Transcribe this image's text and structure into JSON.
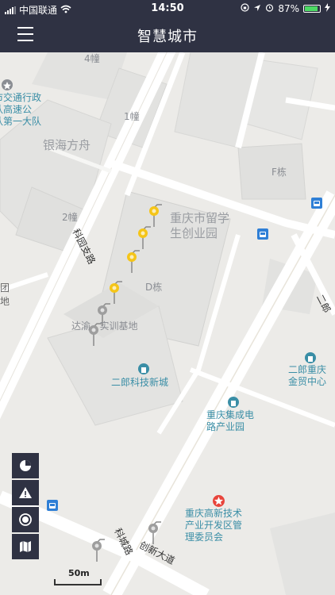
{
  "status_bar": {
    "carrier": "中国联通",
    "time": "14:50",
    "battery": "87%",
    "battery_level": 0.87
  },
  "header": {
    "title": "智慧城市"
  },
  "map": {
    "labels": {
      "building_4": "4幢",
      "building_1": "1幢",
      "building_2": "2幢",
      "building_d": "D栋",
      "building_f": "F栋",
      "traffic_police": "市交通行政\n队高速公\n队第一大队",
      "yinhai": "银海方舟",
      "liuxue": "重庆市留学\n生创业园",
      "tuan": "团\n地",
      "dayu": "达渝   实训基地",
      "erlang_keji": "二郎科技新城",
      "jicheng": "重庆集成电\n路产业园",
      "jinmao": "二郎重庆\n金贸中心",
      "gaoxin": "重庆高新技术\n产业开发区管\n理委员会",
      "road_keyuan": "科园支路",
      "road_kecheng": "科城路",
      "road_chuangxin": "创新大道",
      "road_erlang": "二郎"
    },
    "scale": "50m"
  },
  "tools": [
    "pie-chart-icon",
    "warning-icon",
    "record-icon",
    "map-icon"
  ],
  "colors": {
    "bar": "#2f3243",
    "poi_teal": "#3a8ea6",
    "lamp_on": "#f5c518",
    "lamp_off": "#9e9e9e",
    "star": "#e8453c",
    "bus": "#2f7fd6"
  }
}
